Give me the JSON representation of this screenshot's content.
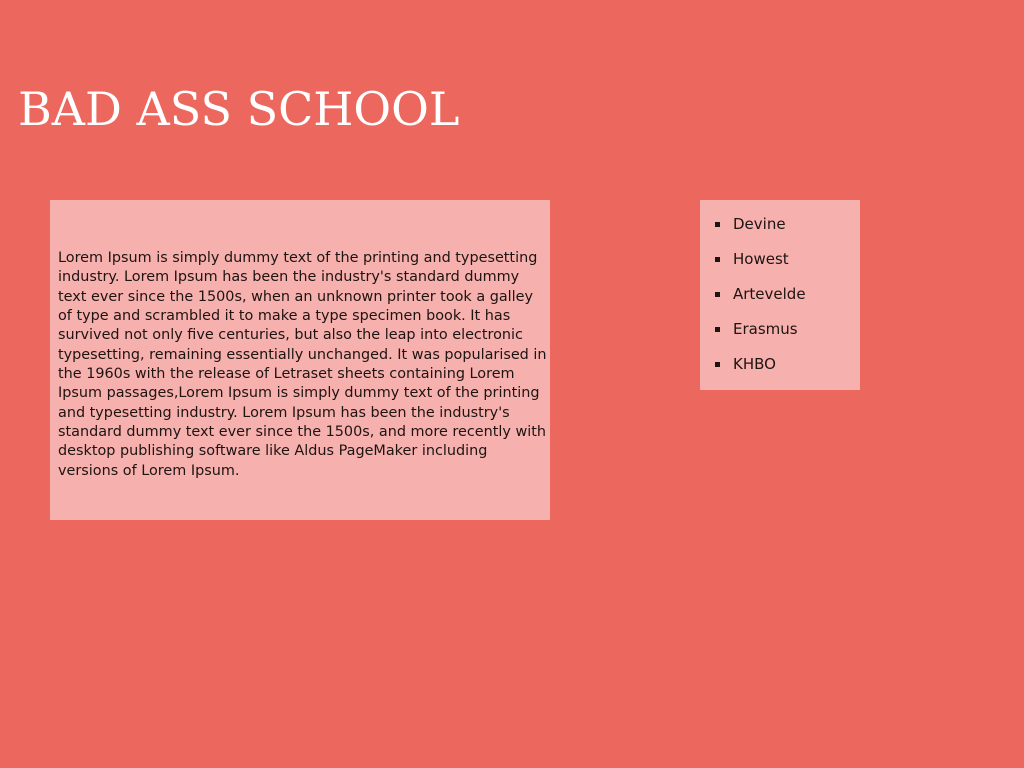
{
  "header": {
    "title": "BAD ASS SCHOOL"
  },
  "article": {
    "text": "Lorem Ipsum is simply dummy text of the printing and typesetting industry. Lorem Ipsum has been the industry's standard dummy text ever since the 1500s, when an unknown printer took a galley of type and scrambled it to make a type specimen book. It has survived not only five centuries, but also the leap into electronic typesetting, remaining essentially unchanged. It was popularised in the 1960s with the release of Letraset sheets containing Lorem Ipsum passages,Lorem Ipsum is simply dummy text of the printing and typesetting industry. Lorem Ipsum has been the industry's standard dummy text ever since the 1500s, and more recently with desktop publishing software like Aldus PageMaker including versions of Lorem Ipsum."
  },
  "schools": {
    "items": [
      {
        "label": "Devine"
      },
      {
        "label": "Howest"
      },
      {
        "label": "Artevelde"
      },
      {
        "label": "Erasmus"
      },
      {
        "label": "KHBO"
      }
    ]
  },
  "colors": {
    "background": "#ec675d",
    "panel": "#f6b0ad",
    "title": "#ffffff",
    "text": "#1e1412"
  }
}
